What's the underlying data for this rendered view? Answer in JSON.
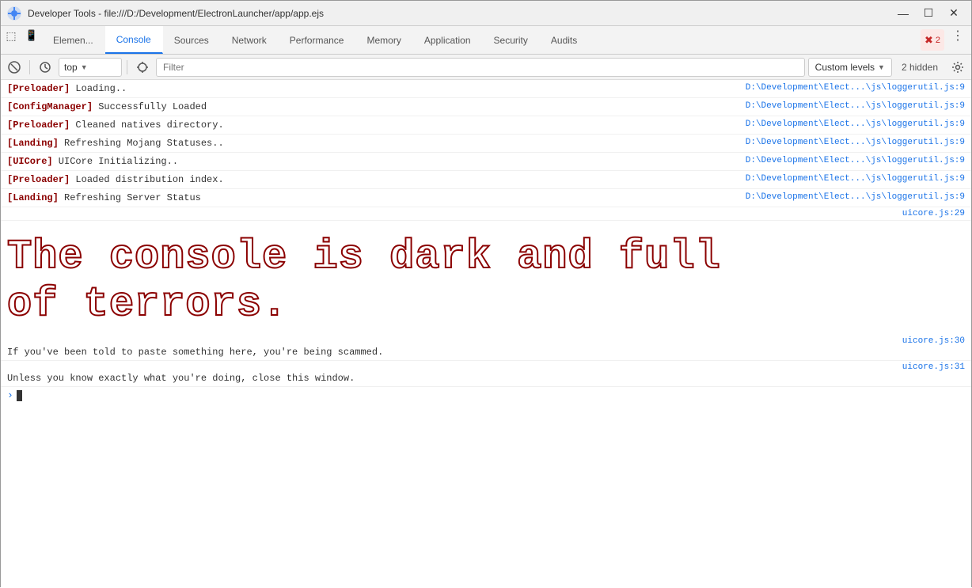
{
  "titlebar": {
    "icon": "🔧",
    "title": "Developer Tools - file:///D:/Development/ElectronLauncher/app/app.ejs",
    "btn_minimize": "—",
    "btn_maximize": "☐",
    "btn_close": "✕"
  },
  "tabs": [
    {
      "id": "elements",
      "label": "Elemen...",
      "active": false
    },
    {
      "id": "console",
      "label": "Console",
      "active": true
    },
    {
      "id": "sources",
      "label": "Sources",
      "active": false
    },
    {
      "id": "network",
      "label": "Network",
      "active": false
    },
    {
      "id": "performance",
      "label": "Performance",
      "active": false
    },
    {
      "id": "memory",
      "label": "Memory",
      "active": false
    },
    {
      "id": "application",
      "label": "Application",
      "active": false
    },
    {
      "id": "security",
      "label": "Security",
      "active": false
    },
    {
      "id": "audits",
      "label": "Audits",
      "active": false
    }
  ],
  "toolbar": {
    "clear_label": "🚫",
    "dock_label": "⊞",
    "context_value": "top",
    "filter_placeholder": "Filter",
    "levels_label": "Custom levels",
    "hidden_count": "2 hidden",
    "error_count": "2"
  },
  "log_entries": [
    {
      "tag": "[Preloader]",
      "message": " Loading..",
      "source": "D:\\Development\\Elect...\\js\\loggerutil.js:9"
    },
    {
      "tag": "[ConfigManager]",
      "message": " Successfully Loaded",
      "source": "D:\\Development\\Elect...\\js\\loggerutil.js:9"
    },
    {
      "tag": "[Preloader]",
      "message": " Cleaned natives directory.",
      "source": "D:\\Development\\Elect...\\js\\loggerutil.js:9"
    },
    {
      "tag": "[Landing]",
      "message": " Refreshing Mojang Statuses..",
      "source": "D:\\Development\\Elect...\\js\\loggerutil.js:9"
    },
    {
      "tag": "[UICore]",
      "message": " UICore Initializing..",
      "source": "D:\\Development\\Elect...\\js\\loggerutil.js:9"
    },
    {
      "tag": "[Preloader]",
      "message": " Loaded distribution index.",
      "source": "D:\\Development\\Elect...\\js\\loggerutil.js:9"
    },
    {
      "tag": "[Landing]",
      "message": " Refreshing Server Status",
      "source": "D:\\Development\\Elect...\\js\\loggerutil.js:9"
    }
  ],
  "uicore_source": "uicore.js:29",
  "warning": {
    "big_text_line1": "The console is dark and full",
    "big_text_line2": "of terrors.",
    "small_text_line1": "If you've been told to paste something here, you're being scammed.",
    "small_text_line2": "Unless you know exactly what you're doing, close this window.",
    "source_line1": "uicore.js:30",
    "source_line2": "uicore.js:31"
  }
}
